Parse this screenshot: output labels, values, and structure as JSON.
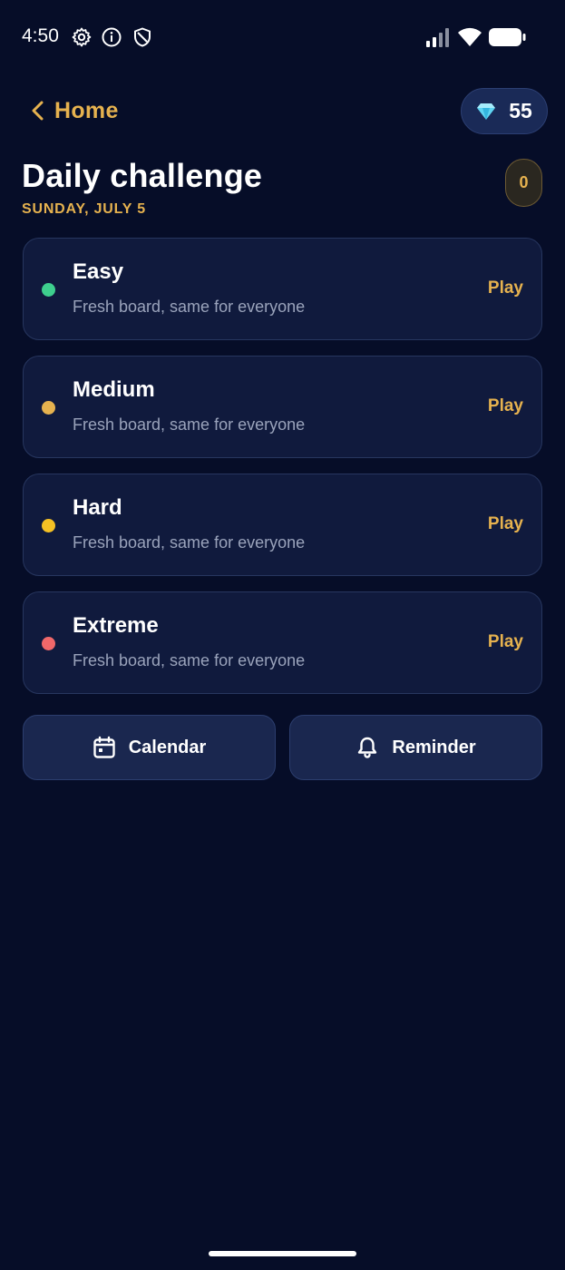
{
  "status_bar": {
    "time": "4:50",
    "left_icons": [
      "gear-icon",
      "info-icon",
      "shield-icon"
    ],
    "right_icons": [
      "signal-icon",
      "wifi-icon",
      "battery-icon"
    ]
  },
  "header": {
    "back_label": "Home",
    "gems": "55",
    "title": "Daily challenge",
    "date": "SUNDAY, JULY 5",
    "streak": "0"
  },
  "challenges": [
    {
      "title": "Easy",
      "subtitle": "Fresh board, same for everyone",
      "action": "Play",
      "color": "#3ecf8e"
    },
    {
      "title": "Medium",
      "subtitle": "Fresh board, same for everyone",
      "action": "Play",
      "color": "#e6b24f"
    },
    {
      "title": "Hard",
      "subtitle": "Fresh board, same for everyone",
      "action": "Play",
      "color": "#f5c124"
    },
    {
      "title": "Extreme",
      "subtitle": "Fresh board, same for everyone",
      "action": "Play",
      "color": "#f0686a"
    }
  ],
  "actions": {
    "calendar_label": "Calendar",
    "reminder_label": "Reminder"
  },
  "colors": {
    "background": "#060d28",
    "accent": "#e6b24f",
    "card": "#101a3d"
  }
}
